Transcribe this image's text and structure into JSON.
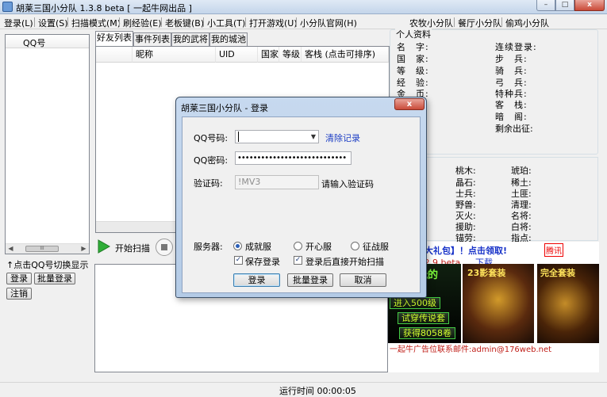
{
  "window": {
    "title": "胡莱三国小分队 1.3.8 beta [ 一起牛网出品 ]",
    "close_glyph": "x",
    "min_glyph": "–",
    "max_glyph": "□"
  },
  "menu": {
    "left": [
      "登录(L)",
      "设置(S)",
      "扫描模式(M)",
      "刷经验(E)",
      "老板键(B)",
      "小工具(T)",
      "打开游戏(U)",
      "小分队官网(H)"
    ],
    "right": [
      "农牧小分队",
      "餐厅小分队",
      "偷鸡小分队"
    ]
  },
  "left_panel": {
    "column_header": "QQ号",
    "hint": "↑点击QQ号切换显示",
    "login_button": "登录",
    "batch_login_button": "批量登录",
    "logout_button": "注销",
    "scroll_thumb": "III"
  },
  "tabs": [
    "好友列表",
    "事件列表",
    "我的武将",
    "我的城池"
  ],
  "friend_table": {
    "columns": [
      "昵称",
      "UID",
      "国家",
      "等级",
      "客栈 (点击可排序)"
    ]
  },
  "scan": {
    "start_label": "开始扫描"
  },
  "profile": {
    "section_title": "个人资料",
    "left_labels": [
      "名　字:",
      "国　家:",
      "等　级:",
      "经　验:",
      "金　币:"
    ],
    "right_labels": [
      "连续登录:",
      "步　兵:",
      "骑　兵:",
      "弓　兵:",
      "特种兵:",
      "客　栈:",
      "暗　阁:",
      "剩余出征:"
    ]
  },
  "resources": {
    "col1": [
      "桃木:",
      "晶石:",
      "士兵:",
      "野兽:",
      "灭火:",
      "援助:",
      "锚劳:"
    ],
    "col2": [
      "琥珀:",
      "稀土:",
      "土匪:",
      "清理:",
      "名将:",
      "白将:",
      "指点:"
    ]
  },
  "ad": {
    "line1": "属【胡莱大礼包】！点击领取!",
    "line1_tag": "腾讯",
    "line2_prefix": "分队】1.2.9 beta",
    "line2_link": "下载",
    "game_text": "得玩的",
    "tag2": "23影套装",
    "tag3": "完全套装",
    "buttons": [
      "进入500级",
      "试穿传说套",
      "获得8058卷"
    ],
    "footer": "一起牛广告位联系邮件:admin@176web.net"
  },
  "status": {
    "runtime": "运行时间 00:00:05"
  },
  "dialog": {
    "title": "胡莱三国小分队 - 登录",
    "qq_label": "QQ号码:",
    "clear_link": "清除记录",
    "password_label": "QQ密码:",
    "password_mask": "••••••••••••••••••••••••••••",
    "captcha_label": "验证码:",
    "captcha_placeholder": "!MV3",
    "captcha_hint": "请输入验证码",
    "server_label": "服务器:",
    "servers": [
      "成就服",
      "开心服",
      "征战服"
    ],
    "selected_server": "成就服",
    "save_login": "保存登录",
    "auto_scan": "登录后直接开始扫描",
    "login_button": "登录",
    "batch_login_button": "批量登录",
    "cancel_button": "取消"
  }
}
